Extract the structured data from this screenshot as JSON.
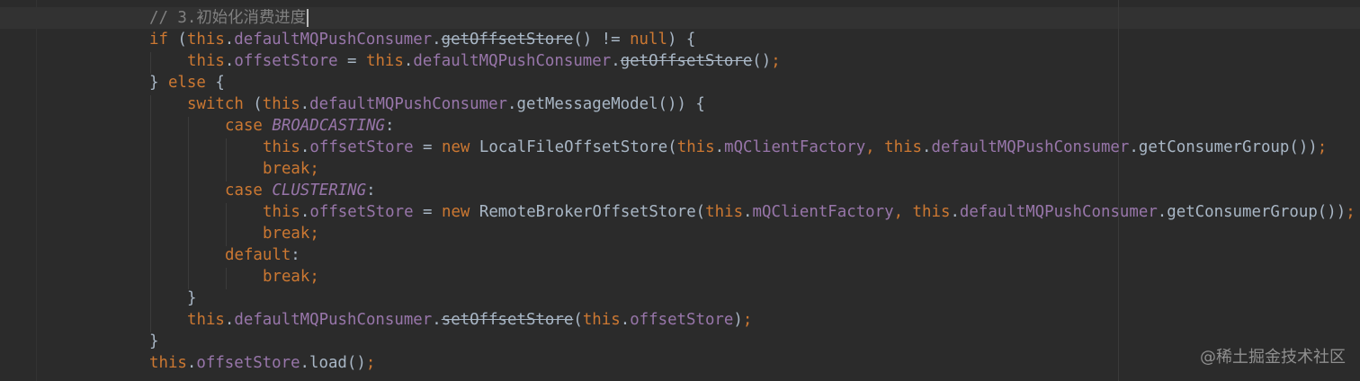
{
  "editor": {
    "colors": {
      "background": "#2b2b2b",
      "caret_row": "#323232",
      "keyword": "#cc7832",
      "field": "#9876aa",
      "plain": "#a9b7c6",
      "comment": "#808080"
    },
    "lines": [
      [
        {
          "t": "// 3.初始化消费进度",
          "c": "comment"
        }
      ],
      [
        {
          "t": "if",
          "c": "keyword"
        },
        {
          "t": " (",
          "c": "plain"
        },
        {
          "t": "this",
          "c": "keyword"
        },
        {
          "t": ".",
          "c": "plain"
        },
        {
          "t": "defaultMQPushConsumer",
          "c": "field"
        },
        {
          "t": ".",
          "c": "plain"
        },
        {
          "t": "getOffsetStore",
          "c": "deprecated"
        },
        {
          "t": "() != ",
          "c": "plain"
        },
        {
          "t": "null",
          "c": "keyword"
        },
        {
          "t": ") {",
          "c": "plain"
        }
      ],
      [
        {
          "t": "this",
          "c": "keyword"
        },
        {
          "t": ".",
          "c": "plain"
        },
        {
          "t": "offsetStore",
          "c": "field"
        },
        {
          "t": " = ",
          "c": "plain"
        },
        {
          "t": "this",
          "c": "keyword"
        },
        {
          "t": ".",
          "c": "plain"
        },
        {
          "t": "defaultMQPushConsumer",
          "c": "field"
        },
        {
          "t": ".",
          "c": "plain"
        },
        {
          "t": "getOffsetStore",
          "c": "deprecated"
        },
        {
          "t": "()",
          "c": "plain"
        },
        {
          "t": ";",
          "c": "keyword"
        }
      ],
      [
        {
          "t": "} ",
          "c": "plain"
        },
        {
          "t": "else",
          "c": "keyword"
        },
        {
          "t": " {",
          "c": "plain"
        }
      ],
      [
        {
          "t": "switch",
          "c": "keyword"
        },
        {
          "t": " (",
          "c": "plain"
        },
        {
          "t": "this",
          "c": "keyword"
        },
        {
          "t": ".",
          "c": "plain"
        },
        {
          "t": "defaultMQPushConsumer",
          "c": "field"
        },
        {
          "t": ".getMessageModel()) {",
          "c": "plain"
        }
      ],
      [
        {
          "t": "case",
          "c": "keyword"
        },
        {
          "t": " ",
          "c": "plain"
        },
        {
          "t": "BROADCASTING",
          "c": "enum"
        },
        {
          "t": ":",
          "c": "plain"
        }
      ],
      [
        {
          "t": "this",
          "c": "keyword"
        },
        {
          "t": ".",
          "c": "plain"
        },
        {
          "t": "offsetStore",
          "c": "field"
        },
        {
          "t": " = ",
          "c": "plain"
        },
        {
          "t": "new",
          "c": "keyword"
        },
        {
          "t": " LocalFileOffsetStore(",
          "c": "plain"
        },
        {
          "t": "this",
          "c": "keyword"
        },
        {
          "t": ".",
          "c": "plain"
        },
        {
          "t": "mQClientFactory",
          "c": "field"
        },
        {
          "t": ", ",
          "c": "keyword"
        },
        {
          "t": "this",
          "c": "keyword"
        },
        {
          "t": ".",
          "c": "plain"
        },
        {
          "t": "defaultMQPushConsumer",
          "c": "field"
        },
        {
          "t": ".getConsumerGroup())",
          "c": "plain"
        },
        {
          "t": ";",
          "c": "keyword"
        }
      ],
      [
        {
          "t": "break;",
          "c": "keyword"
        }
      ],
      [
        {
          "t": "case",
          "c": "keyword"
        },
        {
          "t": " ",
          "c": "plain"
        },
        {
          "t": "CLUSTERING",
          "c": "enum"
        },
        {
          "t": ":",
          "c": "plain"
        }
      ],
      [
        {
          "t": "this",
          "c": "keyword"
        },
        {
          "t": ".",
          "c": "plain"
        },
        {
          "t": "offsetStore",
          "c": "field"
        },
        {
          "t": " = ",
          "c": "plain"
        },
        {
          "t": "new",
          "c": "keyword"
        },
        {
          "t": " RemoteBrokerOffsetStore(",
          "c": "plain"
        },
        {
          "t": "this",
          "c": "keyword"
        },
        {
          "t": ".",
          "c": "plain"
        },
        {
          "t": "mQClientFactory",
          "c": "field"
        },
        {
          "t": ", ",
          "c": "keyword"
        },
        {
          "t": "this",
          "c": "keyword"
        },
        {
          "t": ".",
          "c": "plain"
        },
        {
          "t": "defaultMQPushConsumer",
          "c": "field"
        },
        {
          "t": ".getConsumerGroup())",
          "c": "plain"
        },
        {
          "t": ";",
          "c": "keyword"
        }
      ],
      [
        {
          "t": "break;",
          "c": "keyword"
        }
      ],
      [
        {
          "t": "default",
          "c": "keyword"
        },
        {
          "t": ":",
          "c": "plain"
        }
      ],
      [
        {
          "t": "break;",
          "c": "keyword"
        }
      ],
      [
        {
          "t": "}",
          "c": "plain"
        }
      ],
      [
        {
          "t": "this",
          "c": "keyword"
        },
        {
          "t": ".",
          "c": "plain"
        },
        {
          "t": "defaultMQPushConsumer",
          "c": "field"
        },
        {
          "t": ".",
          "c": "plain"
        },
        {
          "t": "setOffsetStore",
          "c": "deprecated"
        },
        {
          "t": "(",
          "c": "plain"
        },
        {
          "t": "this",
          "c": "keyword"
        },
        {
          "t": ".",
          "c": "plain"
        },
        {
          "t": "offsetStore",
          "c": "field"
        },
        {
          "t": ")",
          "c": "plain"
        },
        {
          "t": ";",
          "c": "keyword"
        }
      ],
      [
        {
          "t": "}",
          "c": "plain"
        }
      ],
      [
        {
          "t": "this",
          "c": "keyword"
        },
        {
          "t": ".",
          "c": "plain"
        },
        {
          "t": "offsetStore",
          "c": "field"
        },
        {
          "t": ".load()",
          "c": "plain"
        },
        {
          "t": ";",
          "c": "keyword"
        }
      ]
    ]
  },
  "watermark": {
    "text": "@稀土掘金技术社区"
  }
}
